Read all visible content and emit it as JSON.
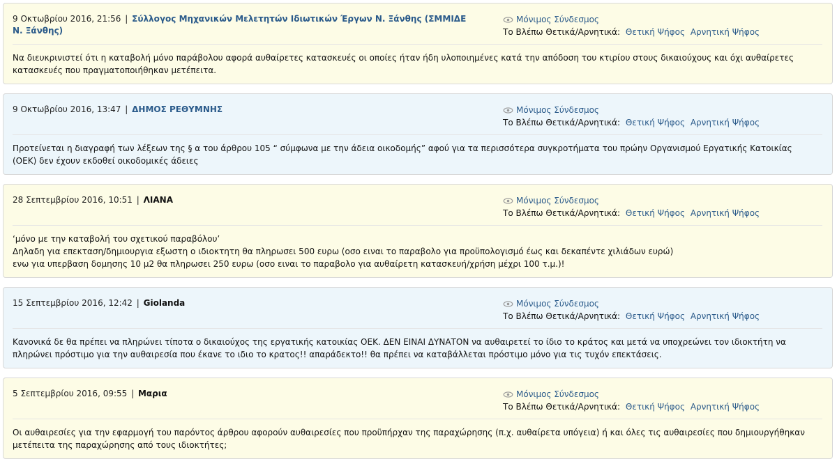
{
  "labels": {
    "permalink": "Μόνιμος Σύνδεσμος",
    "vote_prompt": "Το Βλέπω Θετικά/Αρνητικά:",
    "vote_positive": "Θετική Ψήφος",
    "vote_negative": "Αρνητική Ψήφος",
    "separator": "|"
  },
  "comments": [
    {
      "date": "9 Οκτωβρίου 2016, 21:56",
      "author": "Σύλλογος Μηχανικών Μελετητών Ιδιωτικών Έργων Ν. Ξάνθης (ΣΜΜΙΔΕ Ν. Ξάνθης)",
      "lines": [
        "Να διευκρινιστεί ότι η καταβολή μόνο παράβολου αφορά αυθαίρετες κατασκευές οι οποίες ήταν ήδη υλοποιημένες κατά την απόδοση του κτιρίου στους δικαιούχους και όχι αυθαίρετες κατασκευές που πραγματοποιήθηκαν μετέπειτα."
      ]
    },
    {
      "date": "9 Οκτωβρίου 2016, 13:47",
      "author": "ΔΗΜΟΣ ΡΕΘΥΜΝΗΣ",
      "lines": [
        "Προτείνεται η διαγραφή των λέξεων της § α του άρθρου 105 “ σύμφωνα με την άδεια οικοδομής” αφού για τα περισσότερα συγκροτήματα του πρώην Οργανισμού Εργατικής Κατοικίας (ΟΕΚ) δεν έχουν εκδοθεί οικοδομικές άδειες"
      ]
    },
    {
      "date": "28 Σεπτεμβρίου 2016, 10:51",
      "author": "ΛΙΑΝΑ",
      "lines": [
        "‘μόνο με την καταβολή του σχετικού παραβόλου’",
        "Δηλαδη για επεκταση/δημιουργια εξωστη ο ιδιοκτητη θα πληρωσει 500 ευρω (οσο ειναι το παραβολο για προϋπολογισμό έως και δεκαπέντε χιλιάδων ευρώ)",
        "ενω για υπερβαση δομησης 10 μ2 θα πληρωσει 250 ευρω (οσο ειναι το παραβολο για αυθαίρετη κατασκευή/χρήση μέχρι 100 τ.μ.)!"
      ]
    },
    {
      "date": "15 Σεπτεμβρίου 2016, 12:42",
      "author": "Giolanda",
      "lines": [
        "Κανονικά δε θα πρέπει να πληρώνει τίποτα ο δικαιούχος της εργατικής κατοικίας ΟΕΚ. ΔΕΝ ΕΙΝΑΙ ΔΥΝΑΤΟΝ να αυθαιρετεί το ίδιο το κράτος και μετά να υποχρεώνει τον ιδιοκτήτη να πληρώνει πρόστιμο για την αυθαιρεσία που έκανε το ιδιο το κρατος!! απαράδεκτο!! θα πρέπει να καταβάλλεται πρόστιμο μόνο για τις τυχόν επεκτάσεις."
      ]
    },
    {
      "date": "5 Σεπτεμβρίου 2016, 09:55",
      "author": "Μαρια",
      "lines": [
        "Οι αυθαιρεσίες για την εφαρμογή του παρόντος άρθρου αφορούν αυθαιρεσίες που προϋπήρχαν της παραχώρησης (π.χ. αυθαίρετα υπόγεια) ή και όλες τις αυθαιρεσίες που δημιουργήθηκαν μετέπειτα της παραχώρησης από τους ιδιοκτήτες;"
      ]
    }
  ]
}
